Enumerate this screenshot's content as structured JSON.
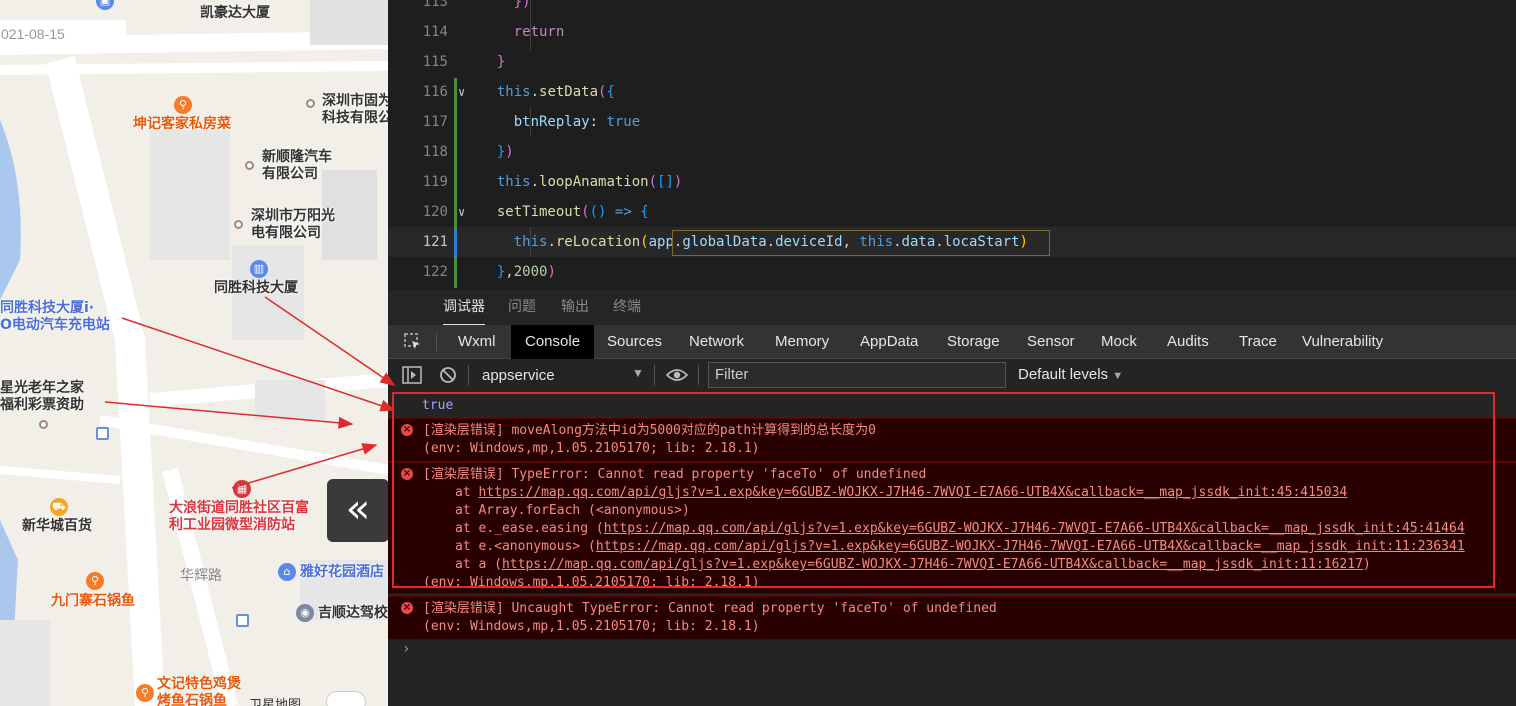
{
  "map": {
    "date_value": "021-08-15",
    "collapse_glyph": "«",
    "road_label": "华辉路",
    "bottom_label": "卫星地图",
    "pois": [
      {
        "text": "凯豪达大厦"
      },
      {
        "text": "深圳市固为\n科技有限公"
      },
      {
        "text": "坤记客家私房菜"
      },
      {
        "text": "新顺隆汽车\n有限公司"
      },
      {
        "text": "深圳市万阳光\n电有限公司"
      },
      {
        "text": "同胜科技大厦"
      },
      {
        "text": "同胜科技大厦i·\nO电动汽车充电站"
      },
      {
        "text": "星光老年之家\n福利彩票资助"
      },
      {
        "text": "大浪街道同胜社区百富\n利工业园微型消防站"
      },
      {
        "text": "新华城百货"
      },
      {
        "text": "雅好花园酒店"
      },
      {
        "text": "九门寨石锅鱼"
      },
      {
        "text": "吉顺达驾校"
      },
      {
        "text": "文记特色鸡煲\n烤鱼石锅鱼"
      }
    ]
  },
  "editor": {
    "lines": [
      {
        "num": "113",
        "code": "    })"
      },
      {
        "num": "114",
        "code": "    return"
      },
      {
        "num": "115",
        "code": "  }"
      },
      {
        "num": "116",
        "code": "  this.setData({"
      },
      {
        "num": "117",
        "code": "    btnReplay: true"
      },
      {
        "num": "118",
        "code": "  })"
      },
      {
        "num": "119",
        "code": "  this.loopAnamation([])"
      },
      {
        "num": "120",
        "code": "  setTimeout(() => {"
      },
      {
        "num": "121",
        "code": "    this.reLocation(app.globalData.deviceId, this.data.locaStart)"
      },
      {
        "num": "122",
        "code": "  },2000)"
      }
    ]
  },
  "panel_tabs": [
    "调试器",
    "问题",
    "输出",
    "终端"
  ],
  "devtools_tabs": [
    "Wxml",
    "Console",
    "Sources",
    "Network",
    "Memory",
    "AppData",
    "Storage",
    "Sensor",
    "Mock",
    "Audits",
    "Trace",
    "Vulnerability"
  ],
  "toolbar": {
    "context": "appservice",
    "filter_placeholder": "Filter",
    "levels": "Default levels"
  },
  "console": {
    "log_true": "true",
    "errors": [
      {
        "lines": [
          "[渲染层错误] moveAlong方法中id为5000对应的path计算得到的总长度为0",
          "(env: Windows,mp,1.05.2105170; lib: 2.18.1)"
        ]
      },
      {
        "title": "[渲染层错误] TypeError: Cannot read property 'faceTo' of undefined",
        "stack": [
          {
            "prefix": "at ",
            "link": "https://map.qq.com/api/gljs?v=1.exp&key=6GUBZ-WOJKX-J7H46-7WVQI-E7A66-UTB4X&callback=__map_jssdk_init:45:415034",
            "suffix": ""
          },
          {
            "prefix": "at Array.forEach (<anonymous>)",
            "link": "",
            "suffix": ""
          },
          {
            "prefix": "at e._ease.easing (",
            "link": "https://map.qq.com/api/gljs?v=1.exp&key=6GUBZ-WOJKX-J7H46-7WVQI-E7A66-UTB4X&callback=__map_jssdk_init:45:41464",
            "suffix": ""
          },
          {
            "prefix": "at e.<anonymous> (",
            "link": "https://map.qq.com/api/gljs?v=1.exp&key=6GUBZ-WOJKX-J7H46-7WVQI-E7A66-UTB4X&callback=__map_jssdk_init:11:236341",
            "suffix": ""
          },
          {
            "prefix": "at a (",
            "link": "https://map.qq.com/api/gljs?v=1.exp&key=6GUBZ-WOJKX-J7H46-7WVQI-E7A66-UTB4X&callback=__map_jssdk_init:11:16217",
            "suffix": ")"
          }
        ],
        "env": "(env: Windows,mp,1.05.2105170; lib: 2.18.1)"
      },
      {
        "lines": [
          "[渲染层错误] Uncaught TypeError: Cannot read property 'faceTo' of undefined",
          "(env: Windows,mp,1.05.2105170; lib: 2.18.1)"
        ]
      }
    ],
    "prompt": "›"
  },
  "colors": {
    "error_bg": "#290000",
    "error_text": "#f28b82",
    "annotation_red": "#e02b2b",
    "editor_bg": "#1e1e1e"
  }
}
